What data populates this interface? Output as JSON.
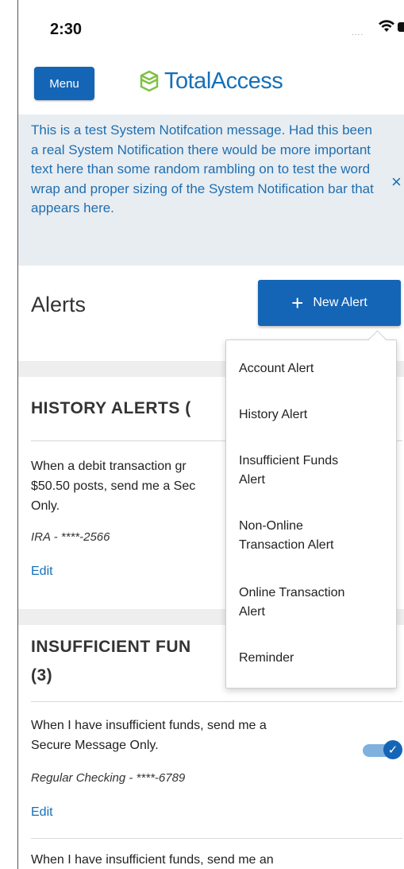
{
  "status_bar": {
    "time": "2:30",
    "signal": "....",
    "icons": [
      "wifi-icon",
      "battery-icon"
    ]
  },
  "header": {
    "menu_label": "Menu",
    "logo_text": "TotalAccess",
    "logo_color": "#1670b8",
    "logo_mark_color": "#7cc242"
  },
  "system_notification": {
    "message": "This is a test System Notifcation message. Had this been a real System Notification there would be more important text here than some random rambling on to test the word wrap and proper sizing of the System Notification bar that appears here.",
    "close_glyph": "×"
  },
  "page": {
    "title": "Alerts",
    "new_alert_label": "New Alert",
    "new_alert_glyph": "+"
  },
  "history_section": {
    "title": "HISTORY ALERTS (",
    "row": {
      "line1": "When a debit transaction gr",
      "line2": "$50.50 posts, send me a Sec",
      "line3": "Only.",
      "account": "IRA - ****-2566",
      "edit_label": "Edit"
    }
  },
  "insufficient_section": {
    "title_line1": "INSUFFICIENT FUN",
    "title_line2": "(3)",
    "row1": {
      "line1": "When I have insufficient funds, send me a",
      "line2": "Secure Message Only.",
      "account": "Regular Checking - ****-6789",
      "edit_label": "Edit",
      "toggle_on": true,
      "toggle_glyph": "✓"
    },
    "row2": {
      "line1": "When I have insufficient funds, send me an"
    }
  },
  "dropdown": {
    "items": [
      {
        "lines": [
          "Account Alert"
        ]
      },
      {
        "lines": [
          "History Alert"
        ]
      },
      {
        "lines": [
          "Insufficient Funds",
          "Alert"
        ]
      },
      {
        "lines": [
          "Non-Online",
          "Transaction Alert"
        ]
      },
      {
        "lines": [
          "Online Transaction",
          "Alert"
        ]
      },
      {
        "lines": [
          "Reminder"
        ]
      }
    ]
  },
  "colors": {
    "primary": "#1565b6",
    "link": "#1670b8",
    "notification_bg": "#e8edf2",
    "notification_text": "#1f6fb0",
    "section_gap": "#eeeeee"
  }
}
